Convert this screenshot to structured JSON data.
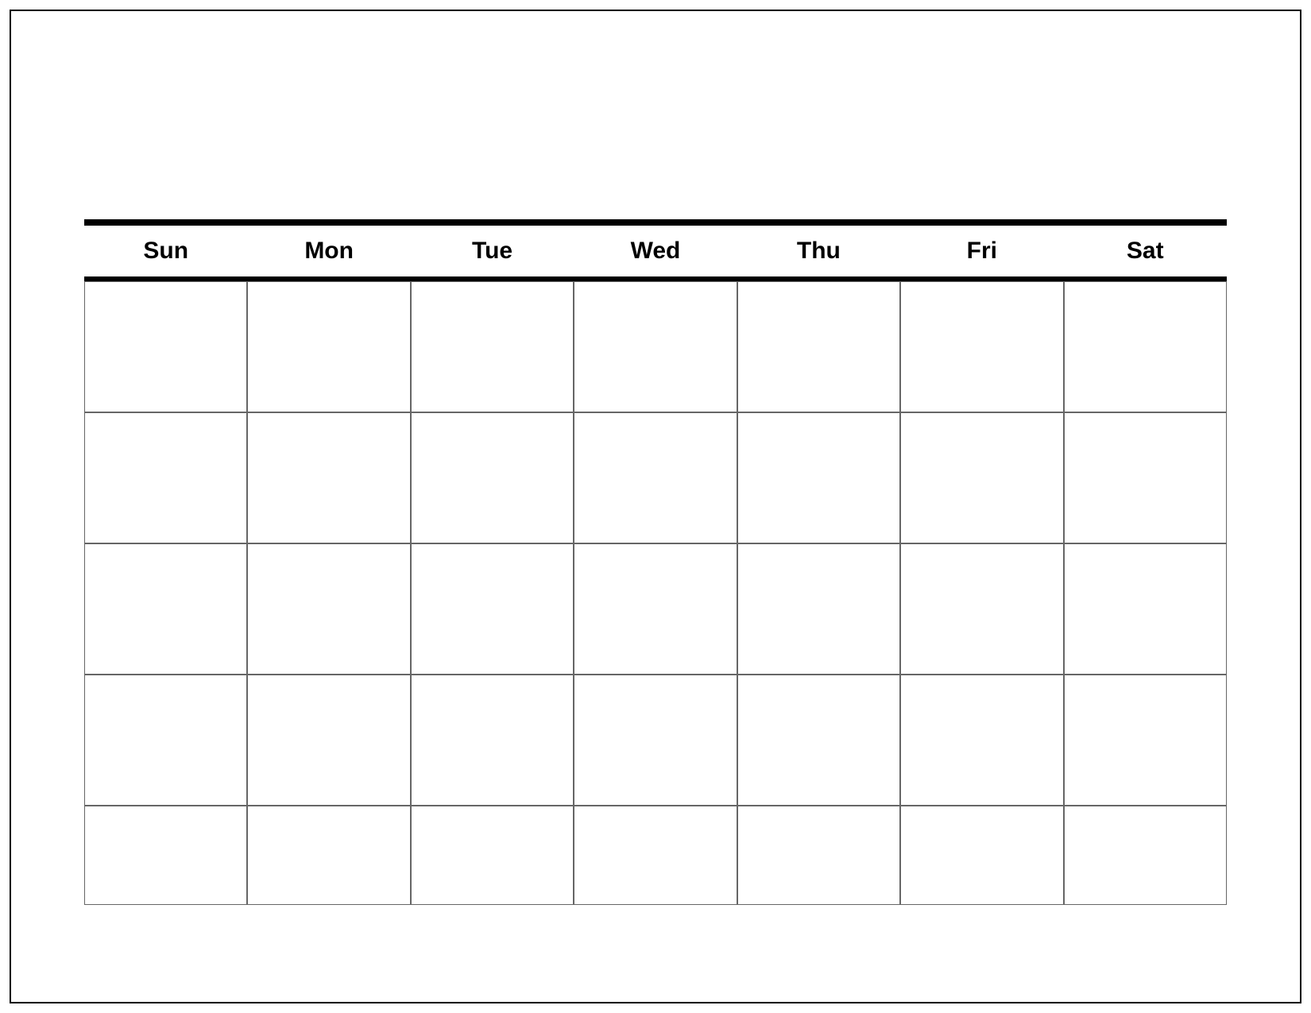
{
  "calendar": {
    "days": [
      "Sun",
      "Mon",
      "Tue",
      "Wed",
      "Thu",
      "Fri",
      "Sat"
    ],
    "rows": 5,
    "cols": 7
  }
}
